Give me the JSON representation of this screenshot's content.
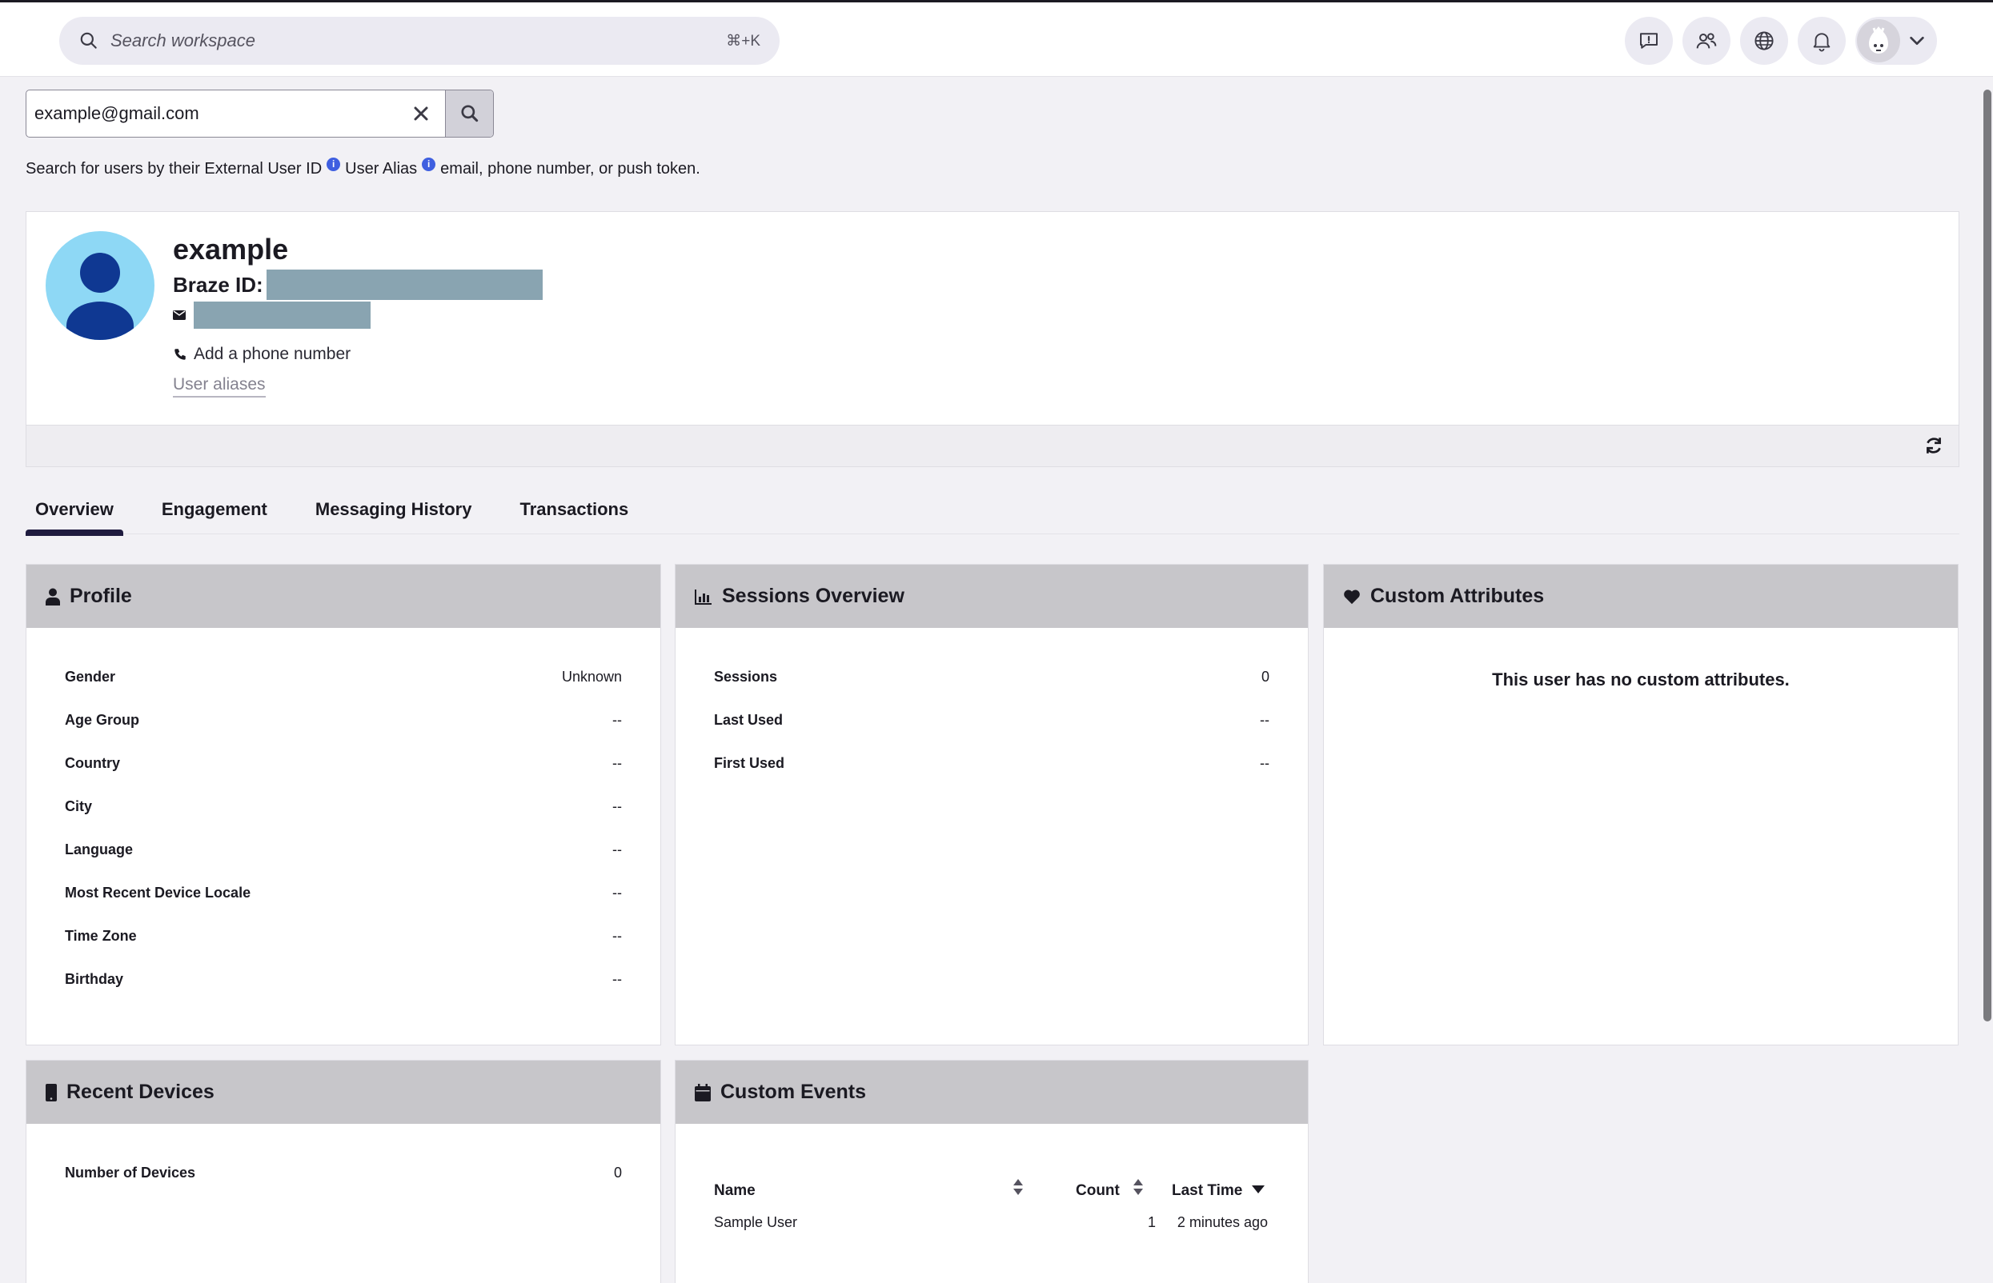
{
  "topbar": {
    "search_placeholder": "Search workspace",
    "shortcut": "⌘+K",
    "icons": [
      "feedback-icon",
      "users-icon",
      "globe-icon",
      "bell-icon",
      "user-menu-avatar",
      "chevron-down-icon"
    ]
  },
  "user_search": {
    "value": "example@gmail.com",
    "hint_part1": "Search for users by their External User ID",
    "hint_part2": "User Alias",
    "hint_part3": "email, phone number, or push token.",
    "info_glyph": "i"
  },
  "profile": {
    "name": "example",
    "braze_id_label": "Braze ID:",
    "phone_action": "Add a phone number",
    "aliases_link": "User aliases"
  },
  "tabs": [
    "Overview",
    "Engagement",
    "Messaging History",
    "Transactions"
  ],
  "panels": {
    "profile": {
      "title": "Profile",
      "rows": [
        {
          "label": "Gender",
          "value": "Unknown"
        },
        {
          "label": "Age Group",
          "value": "--"
        },
        {
          "label": "Country",
          "value": "--"
        },
        {
          "label": "City",
          "value": "--"
        },
        {
          "label": "Language",
          "value": "--"
        },
        {
          "label": "Most Recent Device Locale",
          "value": "--"
        },
        {
          "label": "Time Zone",
          "value": "--"
        },
        {
          "label": "Birthday",
          "value": "--"
        }
      ]
    },
    "sessions": {
      "title": "Sessions Overview",
      "rows": [
        {
          "label": "Sessions",
          "value": "0"
        },
        {
          "label": "Last Used",
          "value": "--"
        },
        {
          "label": "First Used",
          "value": "--"
        }
      ]
    },
    "custom_attributes": {
      "title": "Custom Attributes",
      "empty": "This user has no custom attributes."
    },
    "recent_devices": {
      "title": "Recent Devices",
      "rows": [
        {
          "label": "Number of Devices",
          "value": "0"
        }
      ]
    },
    "custom_events": {
      "title": "Custom Events",
      "columns": [
        "Name",
        "Count",
        "Last Time"
      ],
      "rows": [
        {
          "name": "Sample User",
          "count": "1",
          "last_time": "2 minutes ago"
        }
      ]
    }
  }
}
